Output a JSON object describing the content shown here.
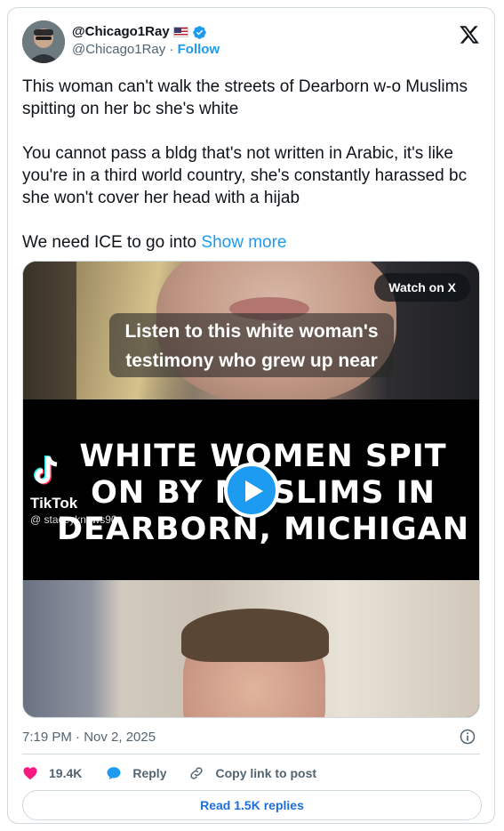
{
  "author": {
    "display_name": "@Chicago1Ray",
    "handle": "@Chicago1Ray",
    "separator": "·",
    "follow_label": "Follow",
    "flag_icon": "us-flag-icon",
    "verified_icon": "verified-badge-icon"
  },
  "tweet": {
    "paragraphs": [
      "This woman can't walk the streets of Dearborn w-o Muslims spitting on her bc she's white",
      "You cannot pass a bldg that's not written in Arabic, it's like you're in a third world country, she's constantly harassed bc she won't cover her head with a hijab"
    ],
    "last_line": "We need ICE to go into",
    "show_more_label": "Show more"
  },
  "media": {
    "watch_label": "Watch on X",
    "caption": "Listen to this white woman's testimony who grew up near",
    "headline": "WHITE WOMEN SPIT ON BY MUSLIMS IN DEARBORN, MICHIGAN",
    "tiktok_label": "TikTok",
    "tiktok_user": "@ staceyknows90",
    "play_icon": "play-icon"
  },
  "timestamp": "7:19 PM · Nov 2, 2025",
  "actions": {
    "likes": "19.4K",
    "reply_label": "Reply",
    "copy_label": "Copy link to post"
  },
  "read_replies_label": "Read 1.5K replies",
  "colors": {
    "accent": "#1d9bf0",
    "like": "#f91880",
    "muted": "#536471"
  }
}
